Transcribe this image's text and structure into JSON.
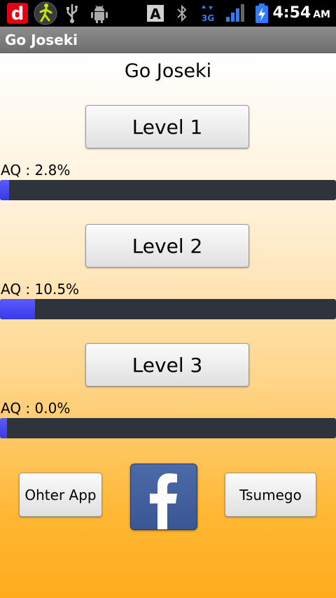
{
  "status_bar": {
    "time": "4:54",
    "ampm": "AM",
    "icons": [
      "docomo-d-icon",
      "walking-man-icon",
      "usb-icon",
      "android-debug-icon",
      "keyboard-a-icon",
      "bluetooth-icon",
      "3g-data-icon",
      "signal-icon",
      "battery-charging-icon"
    ]
  },
  "title_bar": {
    "title": "Go Joseki"
  },
  "main": {
    "heading": "Go Joseki",
    "levels": [
      {
        "label": "Level 1",
        "aq_text": "AQ : 2.8%",
        "progress_percent": 2.8
      },
      {
        "label": "Level 2",
        "aq_text": "AQ : 10.5%",
        "progress_percent": 10.5
      },
      {
        "label": "Level 3",
        "aq_text": "AQ : 0.0%",
        "progress_percent": 0.0
      }
    ]
  },
  "footer": {
    "other_app_label": "Ohter App",
    "facebook_icon": "facebook-icon",
    "tsumego_label": "Tsumego"
  },
  "colors": {
    "progress_fill": "#4444f0",
    "progress_track": "#2f333b",
    "facebook_blue": "#3b5998",
    "gradient_bottom": "#ffab1c"
  }
}
